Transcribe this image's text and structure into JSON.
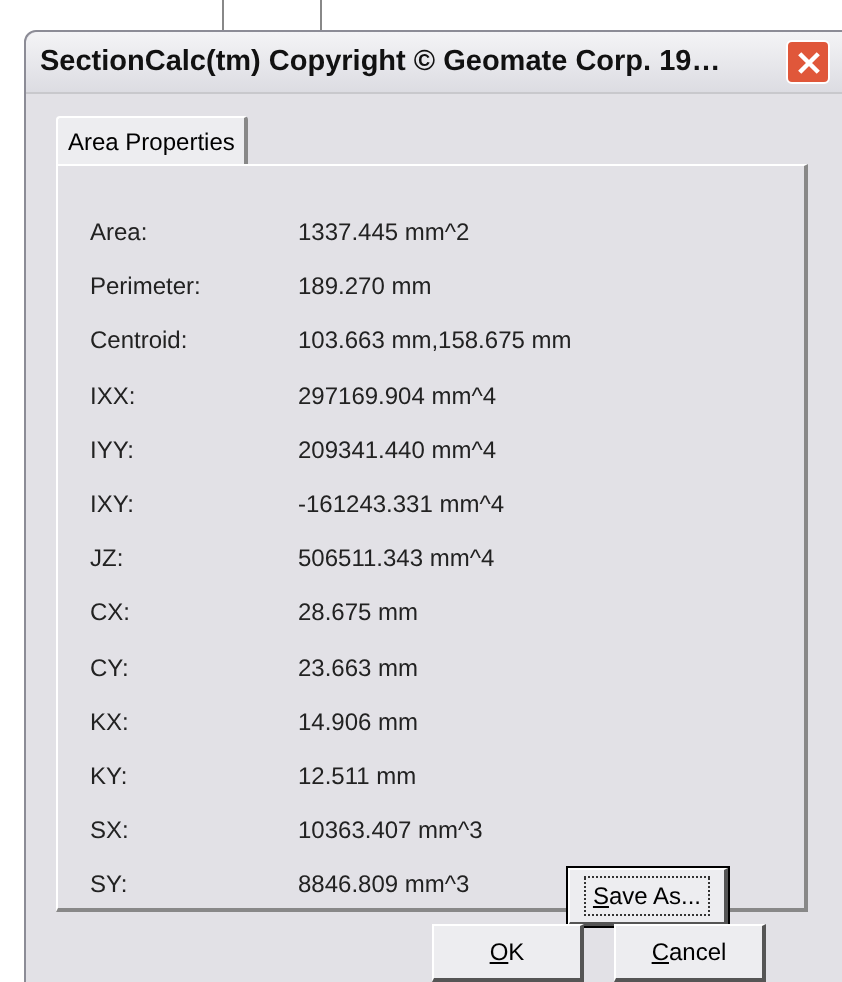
{
  "window": {
    "title": "SectionCalc(tm) Copyright © Geomate Corp. 19…"
  },
  "tabs": [
    {
      "label": "Area Properties",
      "selected": true
    }
  ],
  "properties": [
    {
      "label": "Area:",
      "value": "1337.445 mm^2"
    },
    {
      "label": "Perimeter:",
      "value": "189.270 mm"
    },
    {
      "label": "Centroid:",
      "value": "103.663 mm,158.675 mm"
    },
    {
      "label": "IXX:",
      "value": "297169.904 mm^4"
    },
    {
      "label": "IYY:",
      "value": "209341.440 mm^4"
    },
    {
      "label": "IXY:",
      "value": "-161243.331 mm^4"
    },
    {
      "label": "JZ:",
      "value": "506511.343 mm^4"
    },
    {
      "label": "CX:",
      "value": "28.675 mm"
    },
    {
      "label": "CY:",
      "value": "23.663 mm"
    },
    {
      "label": "KX:",
      "value": "14.906 mm"
    },
    {
      "label": "KY:",
      "value": "12.511 mm"
    },
    {
      "label": "SX:",
      "value": "10363.407 mm^3"
    },
    {
      "label": "SY:",
      "value": "8846.809 mm^3"
    }
  ],
  "save_button": {
    "label": "Save As..."
  },
  "buttons": [
    "OK",
    "Cancel"
  ]
}
